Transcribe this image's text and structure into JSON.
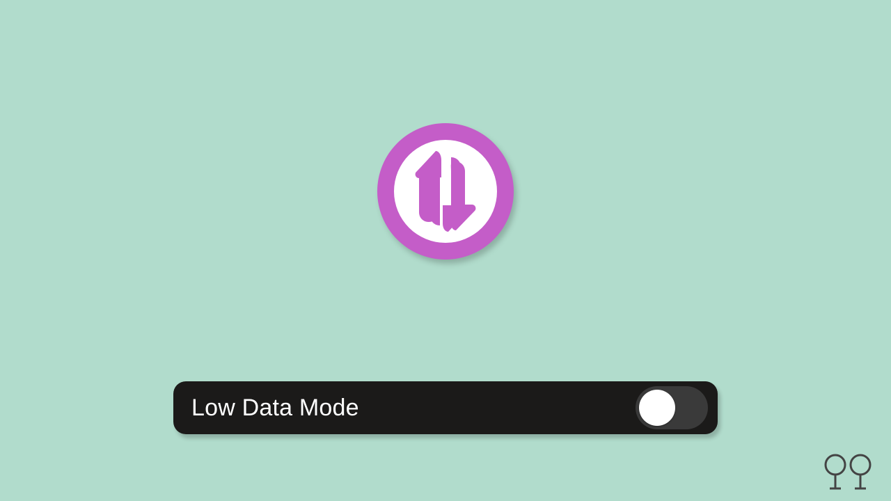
{
  "toggle": {
    "label": "Low Data Mode",
    "state": "off"
  },
  "colors": {
    "background": "#b1dccc",
    "icon_ring": "#c45dc8",
    "icon_inner": "#ffffff",
    "row_bg": "#1b1a19",
    "switch_track": "#3a3a3a",
    "switch_handle": "#ffffff",
    "watermark": "#444444"
  }
}
